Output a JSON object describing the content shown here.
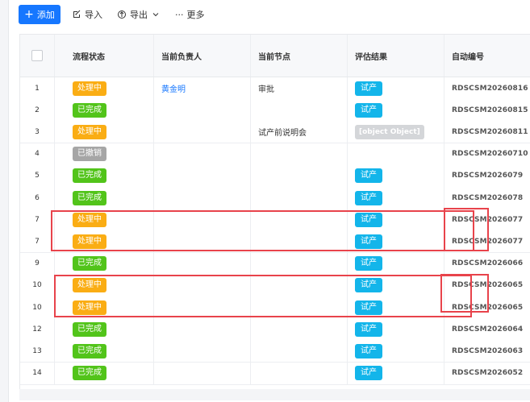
{
  "toolbar": {
    "add_label": "添加",
    "import_label": "导入",
    "export_label": "导出",
    "more_label": "更多"
  },
  "table": {
    "columns": [
      "流程状态",
      "当前负责人",
      "当前节点",
      "评估结果",
      "自动编号"
    ],
    "rows": [
      {
        "index": "1",
        "status": "处理中",
        "status_type": "processing",
        "owner": "黄金明",
        "node": "审批",
        "result": "试产",
        "code": "RDSCSM20260816"
      },
      {
        "index": "2",
        "status": "已完成",
        "status_type": "done",
        "owner": "",
        "node": "",
        "result": "试产",
        "code": "RDSCSM20260815"
      },
      {
        "index": "3",
        "status": "处理中",
        "status_type": "processing",
        "owner": "",
        "node": "试产前说明会",
        "result": "[object Object]",
        "result_type": "object",
        "code": "RDSCSM20260811"
      },
      {
        "index": "4",
        "status": "已撤销",
        "status_type": "revoked",
        "owner": "",
        "node": "",
        "result": "",
        "code": "RDSCSM20260710"
      },
      {
        "index": "5",
        "status": "已完成",
        "status_type": "done",
        "owner": "",
        "node": "",
        "result": "试产",
        "code": "RDSCSM2026079"
      },
      {
        "index": "6",
        "status": "已完成",
        "status_type": "done",
        "owner": "",
        "node": "",
        "result": "试产",
        "code": "RDSCSM2026078"
      },
      {
        "index": "7",
        "status": "处理中",
        "status_type": "processing",
        "owner": "",
        "node": "",
        "result": "试产",
        "code": "RDSCSM2026077"
      },
      {
        "index": "7",
        "status": "处理中",
        "status_type": "processing",
        "owner": "",
        "node": "",
        "result": "试产",
        "code": "RDSCSM2026077"
      },
      {
        "index": "9",
        "status": "已完成",
        "status_type": "done",
        "owner": "",
        "node": "",
        "result": "试产",
        "code": "RDSCSM2026066"
      },
      {
        "index": "10",
        "status": "处理中",
        "status_type": "processing",
        "owner": "",
        "node": "",
        "result": "试产",
        "code": "RDSCSM2026065"
      },
      {
        "index": "10",
        "status": "处理中",
        "status_type": "processing",
        "owner": "",
        "node": "",
        "result": "试产",
        "code": "RDSCSM2026065"
      },
      {
        "index": "12",
        "status": "已完成",
        "status_type": "done",
        "owner": "",
        "node": "",
        "result": "试产",
        "code": "RDSCSM2026064"
      },
      {
        "index": "13",
        "status": "已完成",
        "status_type": "done",
        "owner": "",
        "node": "",
        "result": "试产",
        "code": "RDSCSM2026063"
      },
      {
        "index": "14",
        "status": "已完成",
        "status_type": "done",
        "owner": "",
        "node": "",
        "result": "试产",
        "code": "RDSCSM2026052"
      }
    ]
  },
  "colors": {
    "primary": "#1677ff",
    "processing": "#faad14",
    "done": "#52c41a",
    "revoked": "#a6a6a6",
    "result_tag": "#13b5ea",
    "highlight": "#e8434b"
  },
  "icons": [
    "plus-icon",
    "import-icon",
    "export-icon",
    "chevron-down-icon",
    "more-icon",
    "checkbox-icon"
  ]
}
